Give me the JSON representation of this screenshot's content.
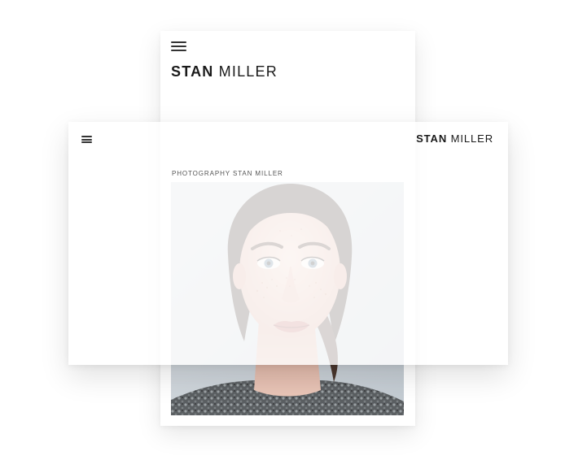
{
  "mobile": {
    "menu_icon": "hamburger-menu-icon",
    "brand_bold": "STAN",
    "brand_light": "MILLER"
  },
  "desktop": {
    "menu_icon": "hamburger-menu-icon",
    "brand_bold": "STAN",
    "brand_light": "MILLER",
    "caption": "PHOTOGRAPHY STAN MILLER"
  },
  "colors": {
    "text": "#1a1a1a",
    "caption": "#555555",
    "photo_background": "#cfd6dc"
  }
}
